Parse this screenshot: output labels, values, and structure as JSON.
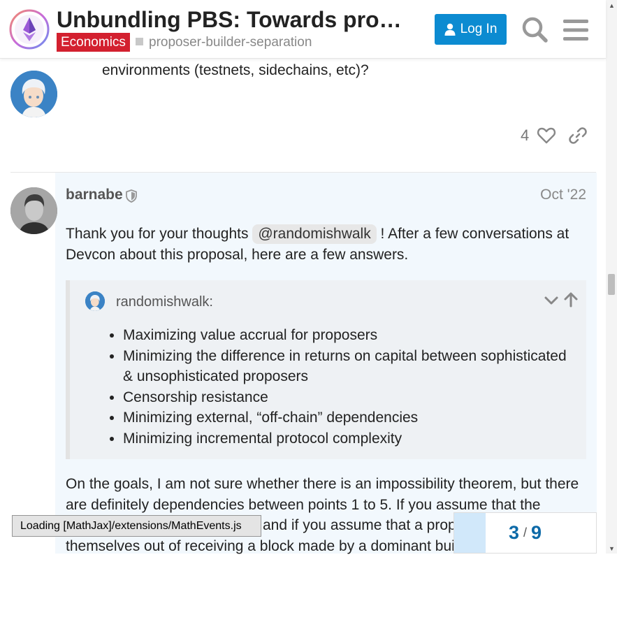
{
  "header": {
    "title": "Unbundling PBS: Towards protocol-enforced proposer commitments (PEPC)",
    "category": "Economics",
    "category_color": "#d3202f",
    "tag": "proposer-builder-separation",
    "login_label": "Log In",
    "search_icon": "search-icon",
    "menu_icon": "hamburger-menu-icon"
  },
  "previous_post": {
    "text": "environments (testnets, sidechains, etc)?",
    "like_count": "4"
  },
  "post": {
    "username": "barnabe",
    "date": "Oct '22",
    "intro_before": "Thank you for your thoughts ",
    "mention": "@randomishwalk",
    "intro_after": " ! After a few conversations at Devcon about this proposal, here are a few answers.",
    "quote": {
      "author": "randomishwalk:",
      "items": [
        "Maximizing value accrual for proposers",
        "Minimizing the difference in returns on capital between sophisticated & unsophisticated proposers",
        "Censorship resistance",
        "Minimizing external, “off-chain” dependencies",
        "Minimizing incremental protocol complexity"
      ]
    },
    "paragraph_line1": "On the goals, I am not sure whether there is an impossibility theorem, but there",
    "paragraph_line2": "are definitely dependencies between points 1 to 5. If you assume that the",
    "paragraph_line3": " and if you assume that a proposer can price",
    "paragraph_line4": "themselves out of receiving a block made by a dominant builder"
  },
  "mathjax_status": "Loading [MathJax]/extensions/MathEvents.js",
  "progress": {
    "current": "3",
    "total": "9",
    "fraction": 0.22
  },
  "colors": {
    "accent": "#0c8bd1",
    "post_highlight": "#f2f8fd"
  }
}
